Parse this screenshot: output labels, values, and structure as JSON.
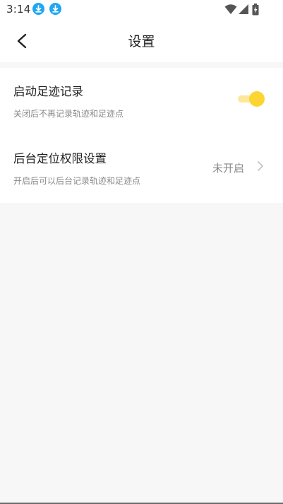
{
  "status_bar": {
    "time": "3:14",
    "icons": [
      "download-icon",
      "download-icon",
      "wifi-icon",
      "signal-icon",
      "battery-charging-icon"
    ]
  },
  "nav": {
    "title": "设置",
    "back_icon": "back-arrow-icon"
  },
  "settings": [
    {
      "title": "启动足迹记录",
      "subtitle": "关闭后不再记录轨迹和足迹点",
      "control": "toggle",
      "enabled": true
    },
    {
      "title": "后台定位权限设置",
      "subtitle": "开启后可以后台记录轨迹和足迹点",
      "status": "未开启",
      "control": "chevron-right-icon"
    }
  ],
  "colors": {
    "accent": "#fdd532",
    "accent_track": "#fde79a",
    "download_icon": "#1ea7f2",
    "page_bg": "#f7f7f7"
  }
}
